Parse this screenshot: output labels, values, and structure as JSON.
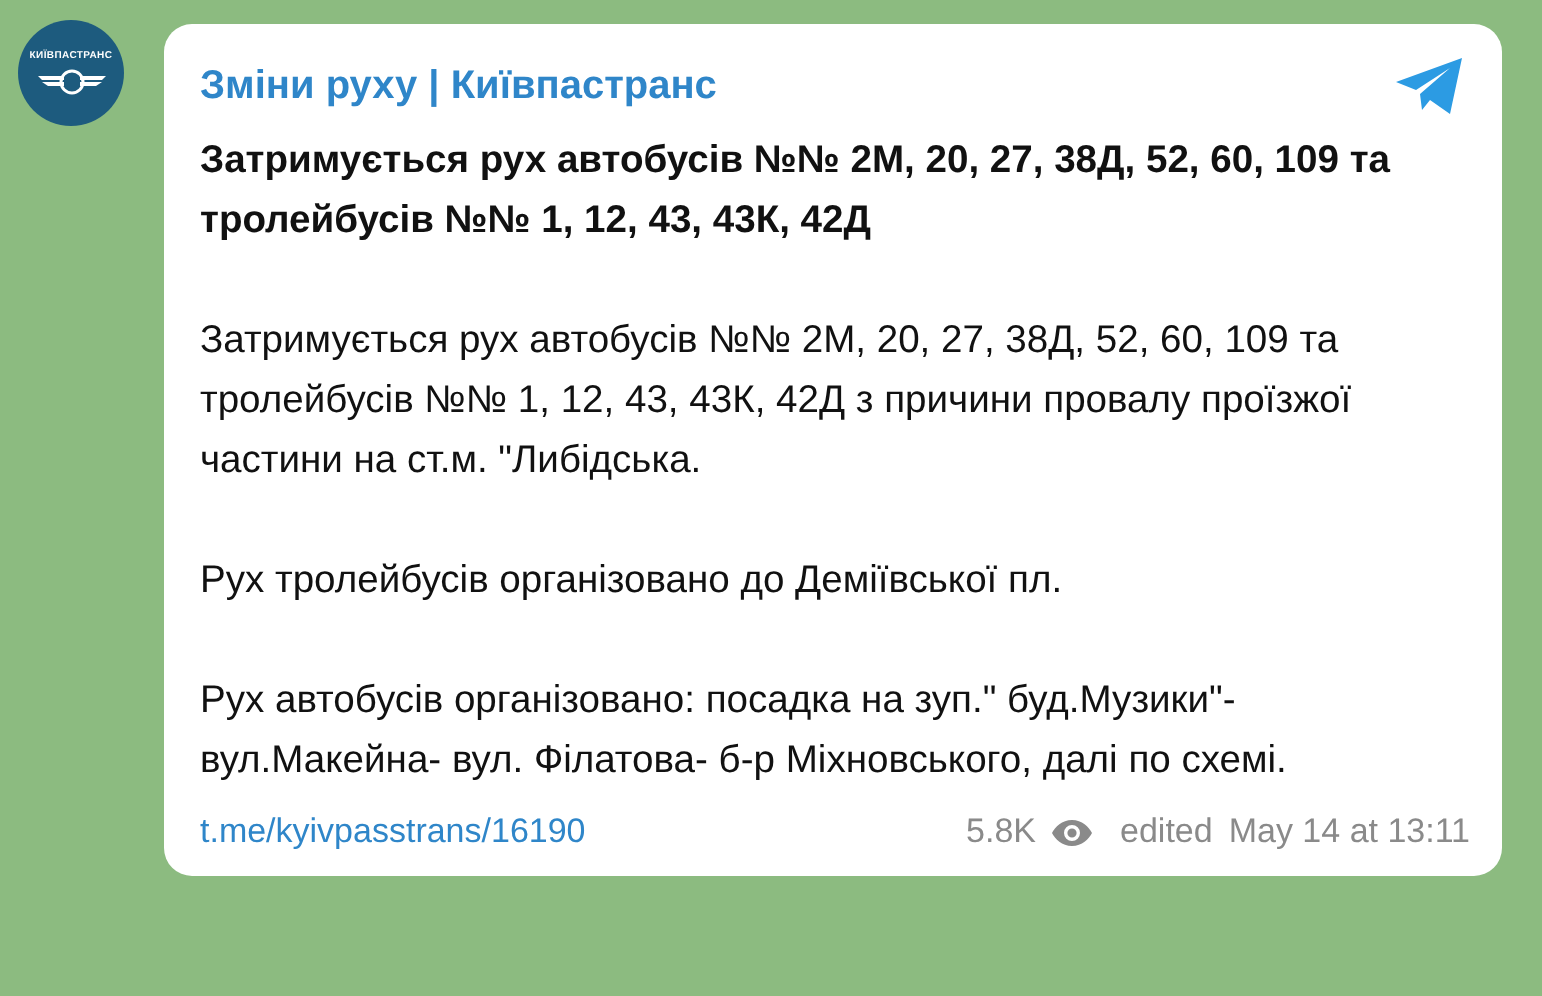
{
  "channel": {
    "avatar_text": "КИЇВПАСТРАНС",
    "name": "Зміни руху | Київпастранс"
  },
  "message": {
    "headline": "Затримується рух автобусів №№ 2M, 20, 27, 38Д, 52, 60, 109 та тролейбусів №№ 1, 12, 43, 43К, 42Д",
    "paragraphs": [
      "Затримується рух автобусів №№ 2M, 20, 27, 38Д, 52, 60, 109 та тролейбусів №№ 1, 12, 43, 43К, 42Д з причини провалу проїзжої частини на ст.м. \"Либідська.",
      "Рух тролейбусів організовано до Деміївської пл.",
      "Рух автобусів організовано: посадка на зуп.\" буд.Музики\"- вул.Макейна- вул. Філатова- б-р Міхновського, далі по схемі."
    ]
  },
  "footer": {
    "link": "t.me/kyivpasstrans/16190",
    "views": "5.8K",
    "edited": "edited",
    "time": "May 14 at 13:11"
  }
}
